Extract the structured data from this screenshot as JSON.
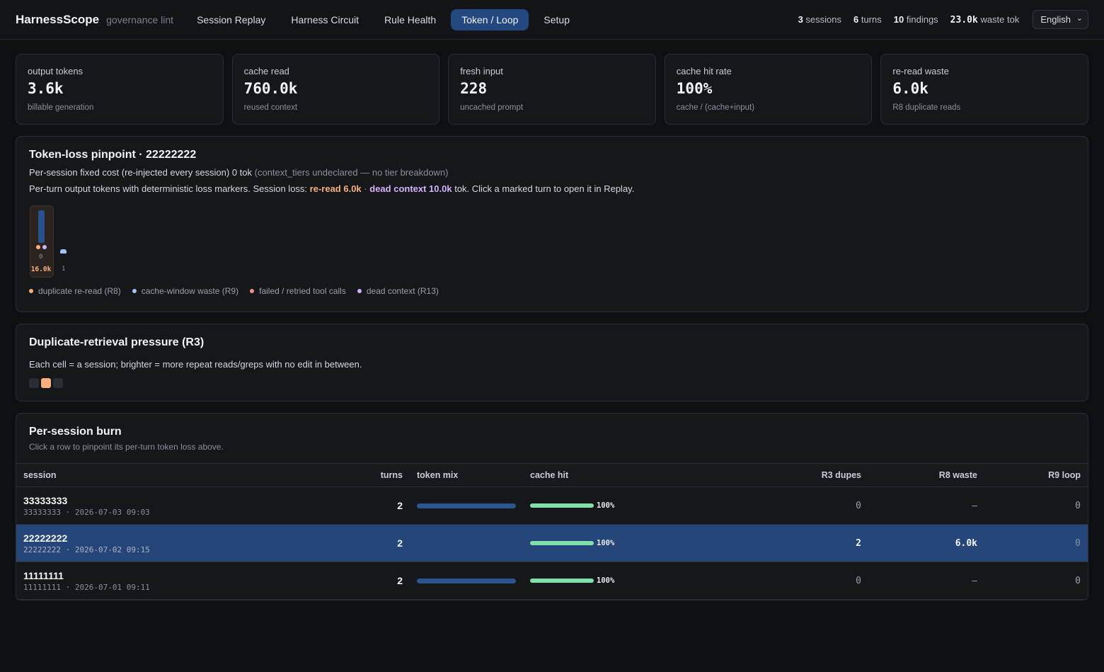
{
  "brand": {
    "name": "HarnessScope",
    "subtitle": "governance lint"
  },
  "nav": {
    "tabs": [
      {
        "label": "Session Replay"
      },
      {
        "label": "Harness Circuit"
      },
      {
        "label": "Rule Health"
      },
      {
        "label": "Token / Loop",
        "active": true
      },
      {
        "label": "Setup"
      }
    ]
  },
  "top_stats": {
    "sessions_value": "3",
    "sessions_label": "sessions",
    "turns_value": "6",
    "turns_label": "turns",
    "findings_value": "10",
    "findings_label": "findings",
    "waste_value": "23.0k",
    "waste_label": "waste tok"
  },
  "language": {
    "selected": "English"
  },
  "kpis": [
    {
      "label": "output tokens",
      "value": "3.6k",
      "sub": "billable generation"
    },
    {
      "label": "cache read",
      "value": "760.0k",
      "sub": "reused context"
    },
    {
      "label": "fresh input",
      "value": "228",
      "sub": "uncached prompt"
    },
    {
      "label": "cache hit rate",
      "value": "100%",
      "sub": "cache / (cache+input)"
    },
    {
      "label": "re-read waste",
      "value": "6.0k",
      "sub": "R8 duplicate reads"
    }
  ],
  "pinpoint": {
    "title": "Token-loss pinpoint · 22222222",
    "fixed_cost_text": "Per-session fixed cost (re-injected every session) 0 tok",
    "fixed_cost_note": "(context_tiers undeclared — no tier breakdown)",
    "desc_prefix": "Per-turn output tokens with deterministic loss markers. Session loss:",
    "reread": "re-read 6.0k",
    "sep": "·",
    "dead": "dead context 10.0k",
    "desc_suffix": "tok. Click a marked turn to open it in Replay.",
    "turns": [
      {
        "index": "0",
        "label": "16.0k",
        "output_level": 0.95,
        "markers": [
          "R8",
          "R13"
        ]
      },
      {
        "index": "1",
        "label": "",
        "output_level": 0.06,
        "markers": []
      }
    ],
    "legend": [
      {
        "label": "duplicate re-read (R8)",
        "color": "#f7b07e"
      },
      {
        "label": "cache-window waste (R9)",
        "color": "#9fc4f5"
      },
      {
        "label": "failed / retried tool calls",
        "color": "#f3928a"
      },
      {
        "label": "dead context (R13)",
        "color": "#d6b1fb"
      }
    ]
  },
  "duplicate": {
    "title": "Duplicate-retrieval pressure (R3)",
    "desc": "Each cell = a session; brighter = more repeat reads/greps with no edit in between.",
    "cells": [
      {
        "color": "#2a2d34"
      },
      {
        "color": "#f7b07e"
      },
      {
        "color": "#2a2d34"
      }
    ]
  },
  "burn": {
    "title": "Per-session burn",
    "subtitle": "Click a row to pinpoint its per-turn token loss above.",
    "columns": {
      "session": "session",
      "turns": "turns",
      "mix": "token mix",
      "hit": "cache hit",
      "r3": "R3 dupes",
      "r8": "R8 waste",
      "r9": "R9 loop"
    },
    "rows": [
      {
        "name": "33333333",
        "meta": "33333333 · 2026-07-03 09:03",
        "turns": "2",
        "mix_fill": 1.0,
        "hit": "100%",
        "hit_fill": 1.0,
        "r3": "0",
        "r8": "–",
        "r9": "0",
        "selected": false
      },
      {
        "name": "22222222",
        "meta": "22222222 · 2026-07-02 09:15",
        "turns": "2",
        "mix_fill": 0,
        "hit": "100%",
        "hit_fill": 1.0,
        "r3": "2",
        "r8": "6.0k",
        "r9": "0",
        "selected": true
      },
      {
        "name": "11111111",
        "meta": "11111111 · 2026-07-01 09:11",
        "turns": "2",
        "mix_fill": 1.0,
        "hit": "100%",
        "hit_fill": 1.0,
        "r3": "0",
        "r8": "–",
        "r9": "0",
        "selected": false
      }
    ]
  }
}
